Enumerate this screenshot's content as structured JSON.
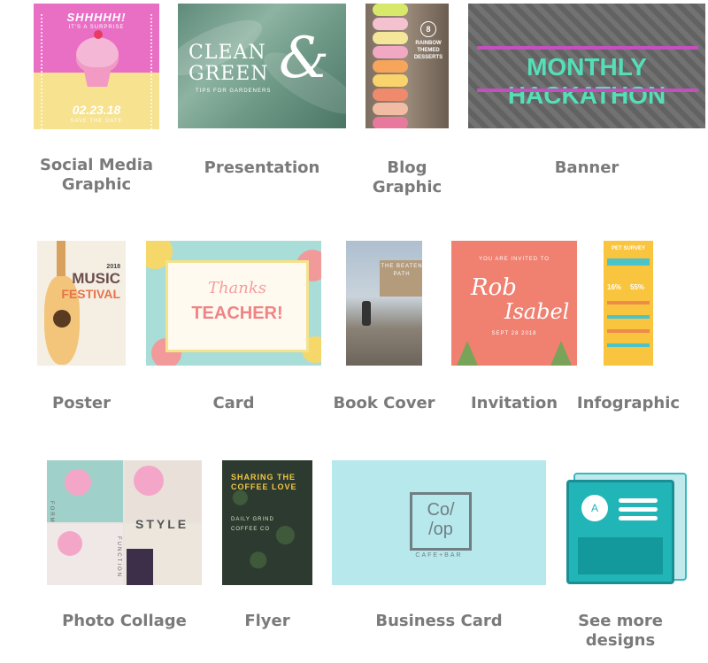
{
  "tiles": {
    "social_media": {
      "label_line1": "Social Media",
      "label_line2": "Graphic",
      "thumb_title": "SHHHHH!",
      "thumb_sub": "IT'S A SURPRISE",
      "thumb_date": "02.23.18",
      "thumb_date_sub": "SAVE THE DATE"
    },
    "presentation": {
      "label": "Presentation",
      "thumb_title_line1": "CLEAN",
      "thumb_title_line2": "GREEN",
      "thumb_amp": "&",
      "thumb_sub": "TIPS FOR GARDENERS"
    },
    "blog": {
      "label_line1": "Blog",
      "label_line2": "Graphic",
      "thumb_num": "8",
      "thumb_text": "RAINBOW THEMED DESSERTS"
    },
    "banner": {
      "label": "Banner",
      "thumb_text": "MONTHLY HACKATHON"
    },
    "poster": {
      "label": "Poster",
      "thumb_year": "2018",
      "thumb_line1": "MUSIC",
      "thumb_line2": "FESTIVAL"
    },
    "card": {
      "label": "Card",
      "thumb_line1": "Thanks",
      "thumb_line2": "TEACHER!"
    },
    "book_cover": {
      "label": "Book Cover",
      "thumb_text": "THE BEATEN PATH"
    },
    "invitation": {
      "label": "Invitation",
      "thumb_small": "YOU ARE INVITED TO",
      "thumb_name1": "Rob",
      "thumb_name2": "Isabel",
      "thumb_date": "SEPT 28 2018"
    },
    "infographic": {
      "label": "Infographic",
      "thumb_title": "PET SURVEY",
      "thumb_pct1": "16%",
      "thumb_pct2": "55%"
    },
    "photo_collage": {
      "label": "Photo Collage",
      "thumb_word": "STYLE",
      "thumb_v1": "FORM",
      "thumb_v2": "FUNCTION"
    },
    "flyer": {
      "label": "Flyer",
      "thumb_head": "SHARING THE COFFEE LOVE",
      "thumb_body": "DAILY GRIND COFFEE CO"
    },
    "business_card": {
      "label": "Business Card",
      "thumb_logo_line1": "Co/",
      "thumb_logo_line2": "/op",
      "thumb_tag": "CAFE+BAR"
    },
    "see_more": {
      "label_line1": "See more",
      "label_line2": "designs",
      "avatar_letter": "A",
      "icon": "stacked-designs-icon"
    }
  },
  "colors": {
    "label_text": "#7a7a7a",
    "accent_teal": "#22b5b8"
  }
}
